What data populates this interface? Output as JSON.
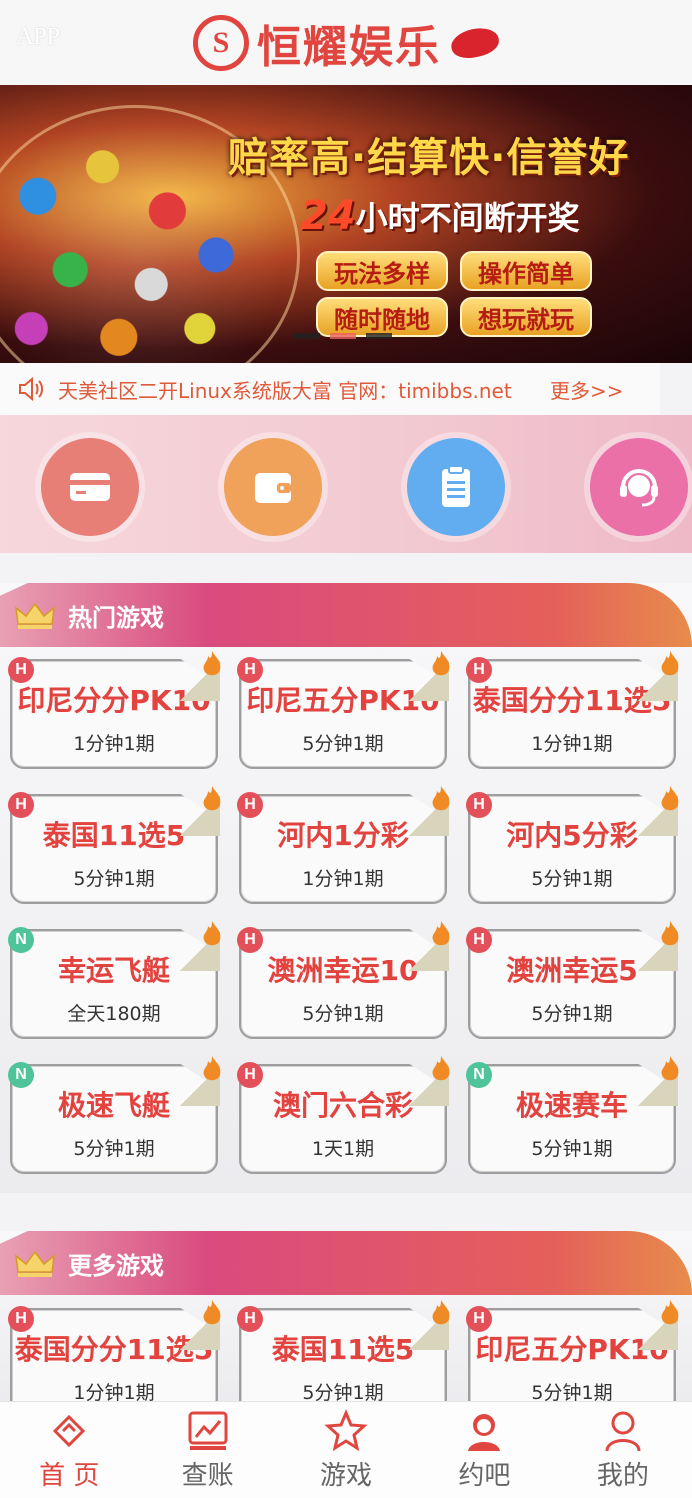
{
  "header": {
    "app_label": "APP",
    "brand_text": "恒耀娱乐",
    "brand_mark": "S"
  },
  "banner": {
    "headline": "赔率高·结算快·信誉好",
    "sub_num": "24",
    "sub_text": "小时不间断开奖",
    "pills": [
      "玩法多样",
      "操作简单",
      "随时随地",
      "想玩就玩"
    ]
  },
  "notice": {
    "text": "天美社区二开Linux系统版大富 官网：timibbs.net",
    "more": "更多>>"
  },
  "quick_actions": [
    {
      "icon": "card-icon",
      "color": "#e77f76"
    },
    {
      "icon": "wallet-icon",
      "color": "#f0a15a"
    },
    {
      "icon": "clipboard-icon",
      "color": "#62acf0"
    },
    {
      "icon": "support-headset-icon",
      "color": "#ec70a8"
    }
  ],
  "hot_section": {
    "title": "热门游戏",
    "games": [
      {
        "name": "印尼分分PK10",
        "period": "1分钟1期",
        "badge": "H"
      },
      {
        "name": "印尼五分PK10",
        "period": "5分钟1期",
        "badge": "H"
      },
      {
        "name": "泰国分分11选5",
        "period": "1分钟1期",
        "badge": "H"
      },
      {
        "name": "泰国11选5",
        "period": "5分钟1期",
        "badge": "H"
      },
      {
        "name": "河内1分彩",
        "period": "1分钟1期",
        "badge": "H"
      },
      {
        "name": "河内5分彩",
        "period": "5分钟1期",
        "badge": "H"
      },
      {
        "name": "幸运飞艇",
        "period": "全天180期",
        "badge": "N"
      },
      {
        "name": "澳洲幸运10",
        "period": "5分钟1期",
        "badge": "H"
      },
      {
        "name": "澳洲幸运5",
        "period": "5分钟1期",
        "badge": "H"
      },
      {
        "name": "极速飞艇",
        "period": "5分钟1期",
        "badge": "N"
      },
      {
        "name": "澳门六合彩",
        "period": "1天1期",
        "badge": "H"
      },
      {
        "name": "极速赛车",
        "period": "5分钟1期",
        "badge": "N"
      }
    ]
  },
  "more_section": {
    "title": "更多游戏",
    "games": [
      {
        "name": "泰国分分11选5",
        "period": "1分钟1期",
        "badge": "H"
      },
      {
        "name": "泰国11选5",
        "period": "5分钟1期",
        "badge": "H"
      },
      {
        "name": "印尼五分PK10",
        "period": "5分钟1期",
        "badge": "H"
      }
    ]
  },
  "tabbar": {
    "tabs": [
      {
        "label": "首 页",
        "icon": "ticket-icon",
        "active": true
      },
      {
        "label": "查账",
        "icon": "chart-icon",
        "active": false
      },
      {
        "label": "游戏",
        "icon": "star-icon",
        "active": false
      },
      {
        "label": "约吧",
        "icon": "girl-icon",
        "active": false
      },
      {
        "label": "我的",
        "icon": "user-icon",
        "active": false
      }
    ]
  },
  "colors": {
    "brand_red": "#e0463f",
    "badge_hot": "#e3505a",
    "badge_new": "#4fc49b"
  }
}
